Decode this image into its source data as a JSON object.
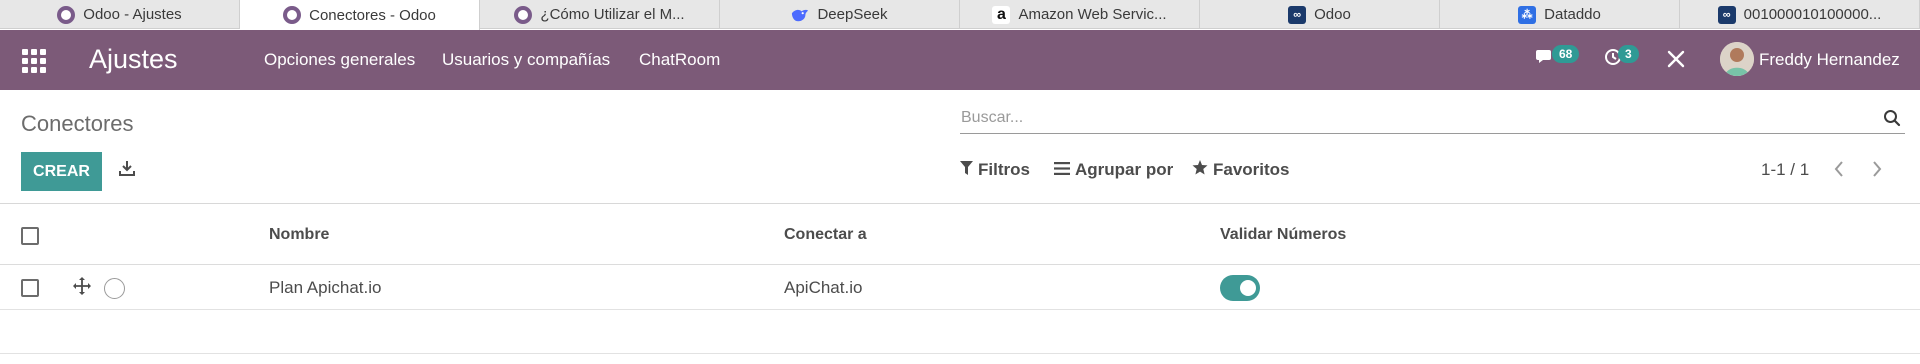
{
  "browser_tabs": [
    {
      "title": "Odoo - Ajustes",
      "icon": "odoo-icon"
    },
    {
      "title": "Conectores - Odoo",
      "icon": "odoo-icon",
      "active": true
    },
    {
      "title": "¿Cómo Utilizar el M...",
      "icon": "odoo-icon"
    },
    {
      "title": "DeepSeek",
      "icon": "deepseek-icon"
    },
    {
      "title": "Amazon Web Servic...",
      "icon": "amazon-icon"
    },
    {
      "title": "Odoo",
      "icon": "infinity-icon"
    },
    {
      "title": "Dataddo",
      "icon": "dataddo-icon"
    },
    {
      "title": "001000010100000...",
      "icon": "infinity-icon"
    }
  ],
  "navbar": {
    "brand": "Ajustes",
    "menu": [
      "Opciones generales",
      "Usuarios y compañías",
      "ChatRoom"
    ],
    "messages_count": "68",
    "activities_count": "3",
    "user_name": "Freddy Hernandez",
    "color": "#7c5a78"
  },
  "control_panel": {
    "title": "Conectores",
    "search_placeholder": "Buscar...",
    "create_label": "CREAR",
    "filters_label": "Filtros",
    "group_by_label": "Agrupar por",
    "favorites_label": "Favoritos",
    "pager": "1-1 / 1",
    "accent": "#3f9a96"
  },
  "table": {
    "columns": [
      "Nombre",
      "Conectar a",
      "Validar Números"
    ],
    "rows": [
      {
        "name": "Plan Apichat.io",
        "connect_to": "ApiChat.io",
        "validate_numbers": true
      }
    ]
  }
}
